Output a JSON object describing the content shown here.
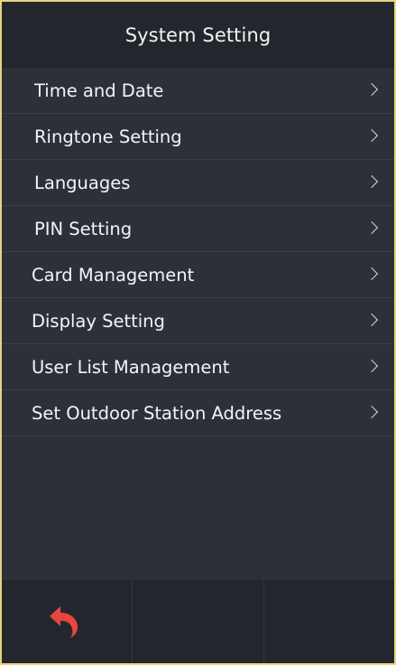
{
  "header": {
    "title": "System Setting"
  },
  "menu": {
    "items": [
      {
        "label": "Time and Date",
        "name": "menu-item-time-and-date"
      },
      {
        "label": "Ringtone Setting",
        "name": "menu-item-ringtone-setting"
      },
      {
        "label": "Languages",
        "name": "menu-item-languages"
      },
      {
        "label": "PIN Setting",
        "name": "menu-item-pin-setting"
      },
      {
        "label": "Card Management",
        "name": "menu-item-card-management"
      },
      {
        "label": "Display Setting",
        "name": "menu-item-display-setting"
      },
      {
        "label": "User List Management",
        "name": "menu-item-user-list-management"
      },
      {
        "label": "Set Outdoor Station Address",
        "name": "menu-item-set-outdoor-station-address"
      }
    ],
    "chevron_icon": "chevron-right-icon"
  },
  "footer": {
    "back_icon": "back-arrow-icon",
    "accent_color": "#e8463f"
  },
  "colors": {
    "background": "#2c3139",
    "header_bg": "#23272d",
    "footer_bg": "#23272d",
    "text": "#f4f4f4",
    "divider": "#3b4048",
    "frame_border": "#e8d37a"
  }
}
